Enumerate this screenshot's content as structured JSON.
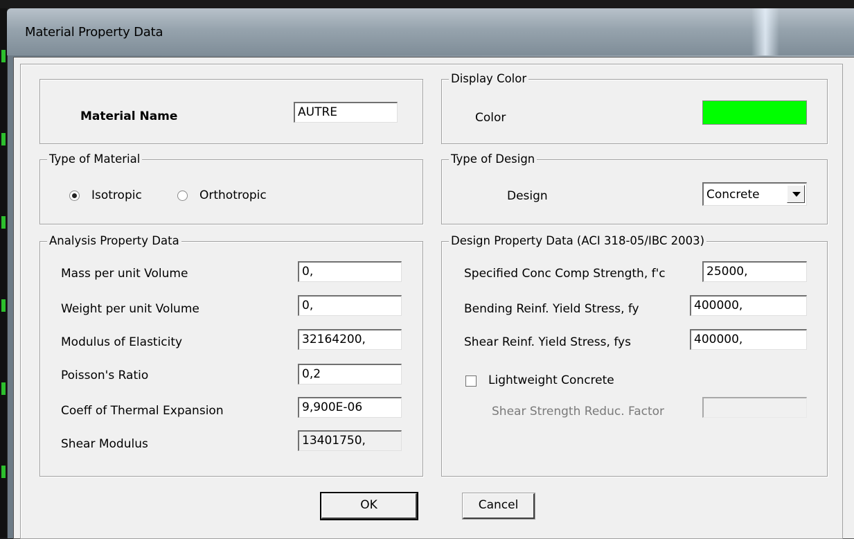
{
  "window": {
    "title": "Material Property Data"
  },
  "material_name": {
    "label": "Material Name",
    "value": "AUTRE"
  },
  "display_color": {
    "legend": "Display Color",
    "label": "Color",
    "color": "#00ff00"
  },
  "type_of_material": {
    "legend": "Type of Material",
    "options": [
      "Isotropic",
      "Orthotropic"
    ],
    "selected": "Isotropic"
  },
  "type_of_design": {
    "legend": "Type of Design",
    "label": "Design",
    "value": "Concrete"
  },
  "analysis": {
    "legend": "Analysis Property Data",
    "rows": [
      {
        "label": "Mass per unit Volume",
        "value": "0,"
      },
      {
        "label": "Weight per unit Volume",
        "value": "0,"
      },
      {
        "label": "Modulus of Elasticity",
        "value": "32164200,"
      },
      {
        "label": "Poisson's Ratio",
        "value": "0,2"
      },
      {
        "label": "Coeff of Thermal Expansion",
        "value": "9,900E-06"
      },
      {
        "label": "Shear Modulus",
        "value": "13401750,"
      }
    ]
  },
  "design": {
    "legend": "Design Property Data (ACI 318-05/IBC 2003)",
    "rows": [
      {
        "label": "Specified Conc Comp Strength, f'c",
        "value": "25000,"
      },
      {
        "label": "Bending Reinf. Yield Stress, fy",
        "value": "400000,"
      },
      {
        "label": "Shear Reinf. Yield Stress, fys",
        "value": "400000,"
      }
    ],
    "lightweight_label": "Lightweight Concrete",
    "lightweight_checked": false,
    "reduc_label": "Shear Strength Reduc. Factor",
    "reduc_value": ""
  },
  "buttons": {
    "ok": "OK",
    "cancel": "Cancel"
  }
}
